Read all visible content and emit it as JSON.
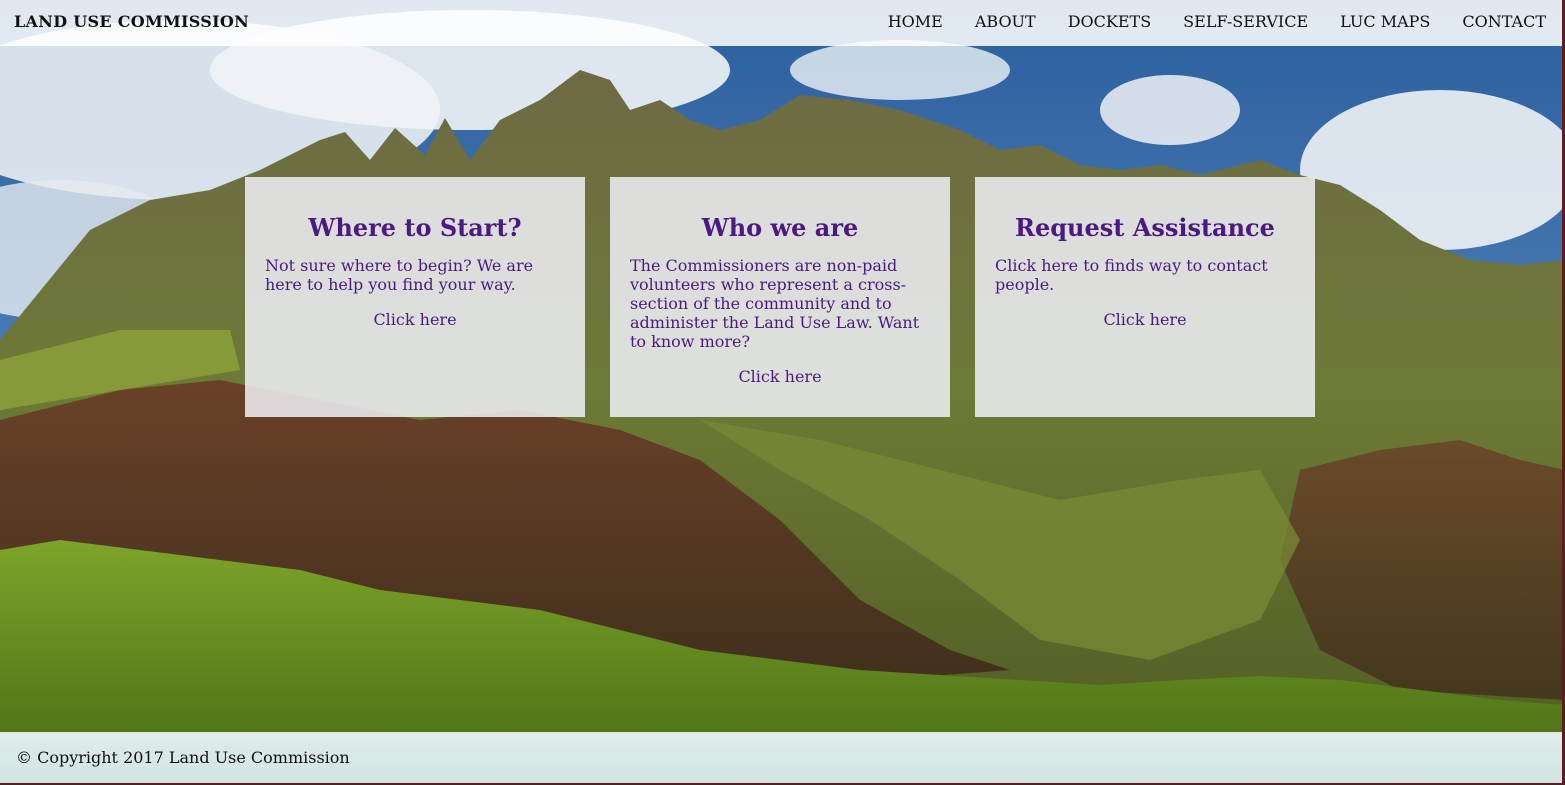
{
  "header": {
    "brand": "LAND USE COMMISSION",
    "nav": [
      "HOME",
      "ABOUT",
      "DOCKETS",
      "SELF-SERVICE",
      "LUC MAPS",
      "CONTACT"
    ]
  },
  "cards": [
    {
      "title": "Where to Start?",
      "text": "Not sure where to begin? We are here to help you find your way.",
      "link": "Click here"
    },
    {
      "title": "Who we are",
      "text": "The Commissioners are non-paid volunteers who represent a cross-section of the community and to administer the Land Use Law. Want to know more?",
      "link": "Click here"
    },
    {
      "title": "Request Assistance",
      "text": "Click here to finds way to contact people.",
      "link": "Click here"
    }
  ],
  "footer": {
    "copyright": "© Copyright 2017 Land Use Commission"
  },
  "colors": {
    "card_text": "#4a1a82",
    "header_bg": "#ffffff",
    "frame": "#5a1e20"
  }
}
